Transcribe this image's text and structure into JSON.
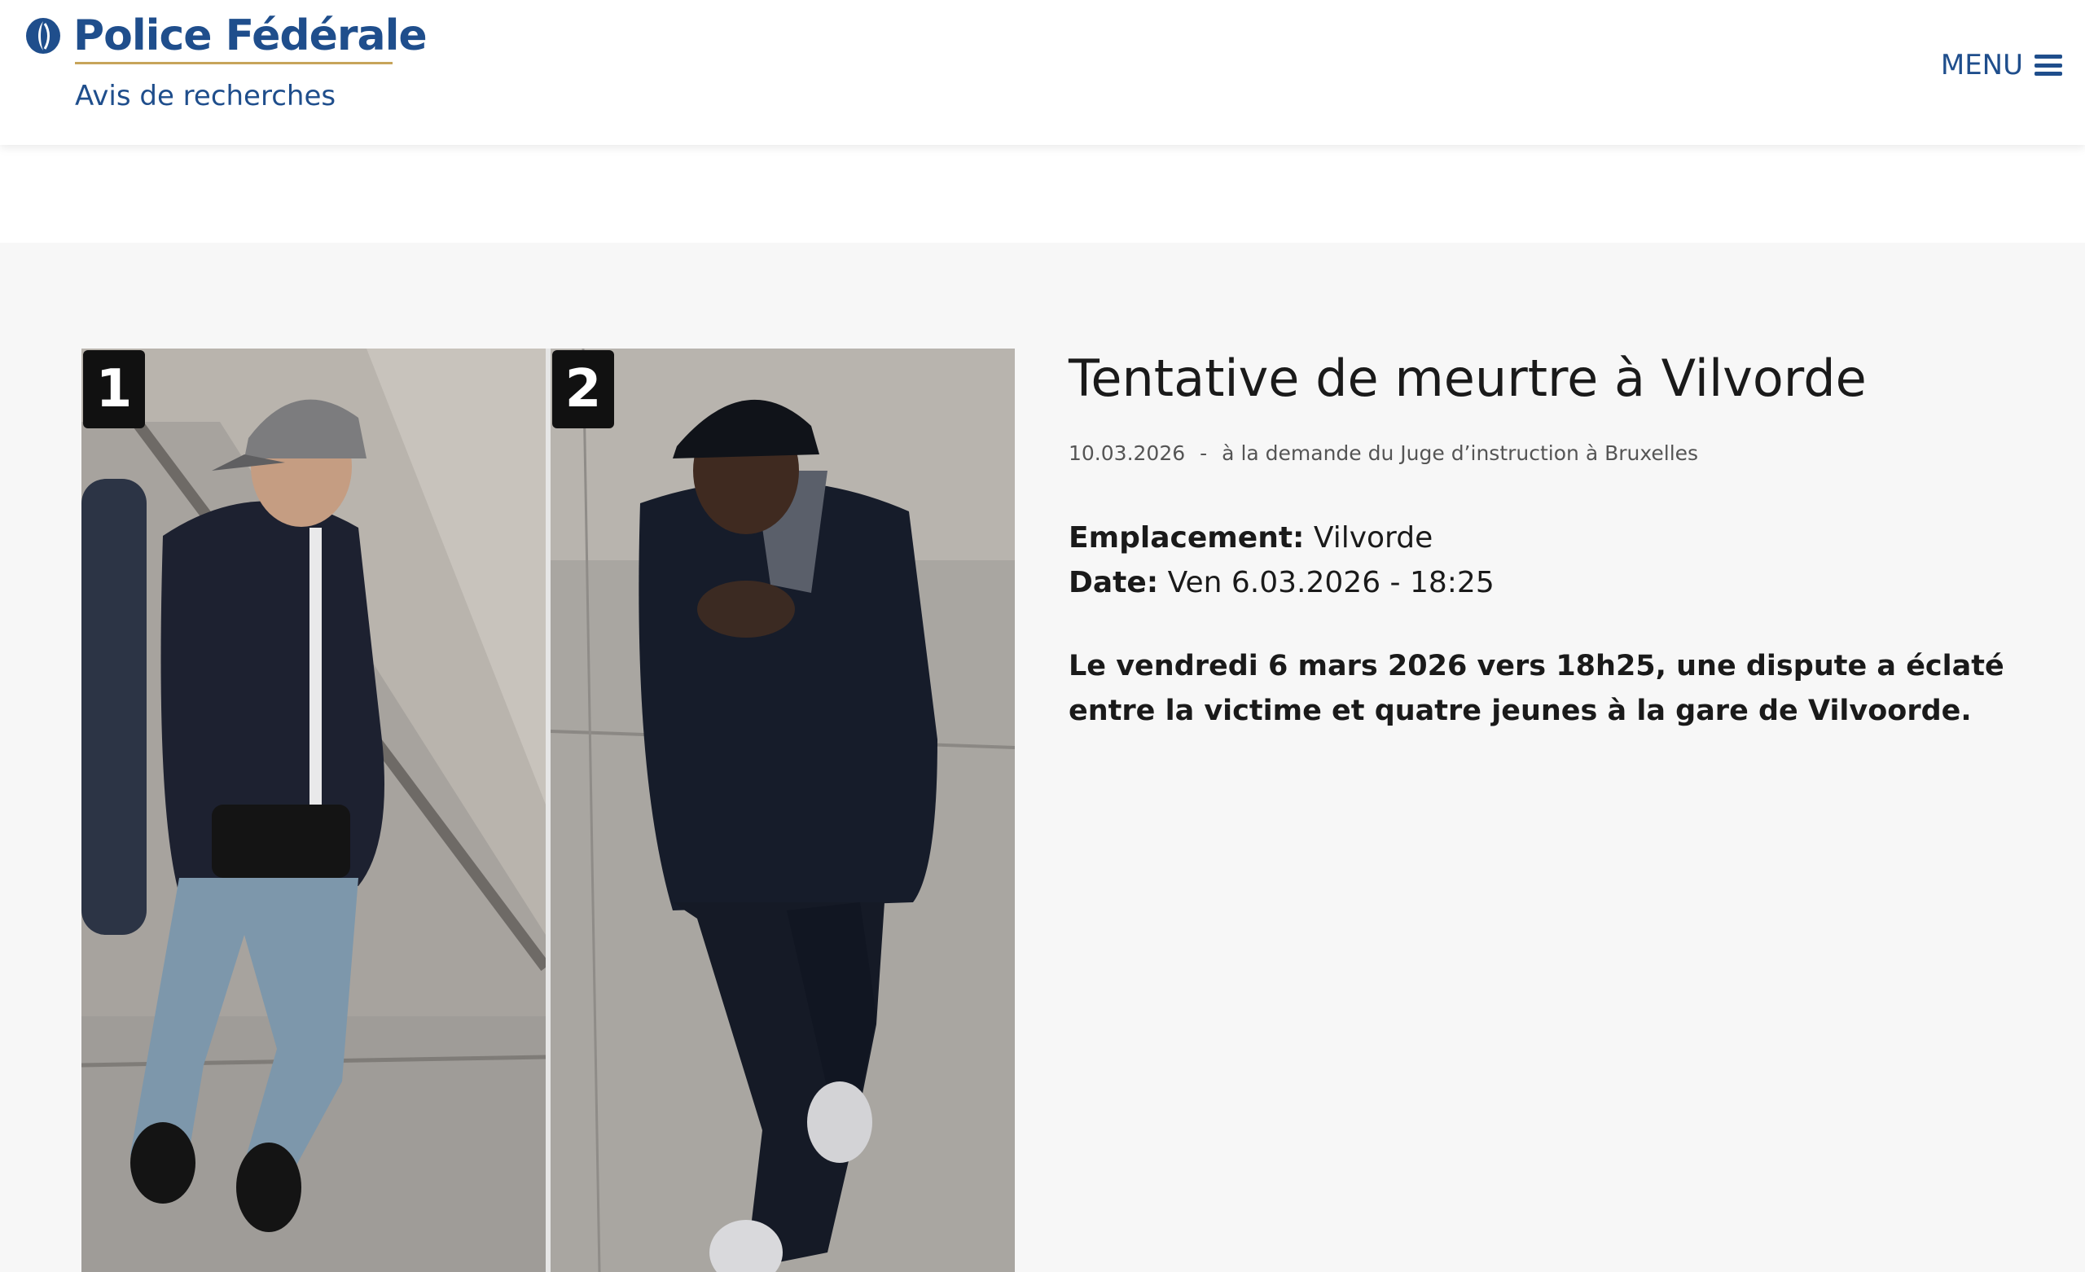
{
  "header": {
    "logo_title": "Police Fédérale",
    "logo_subtitle": "Avis de recherches",
    "menu_label": "MENU",
    "brand_color": "#1f4e8c",
    "accent_color": "#c7a45a"
  },
  "article": {
    "title": "Tentative de meurtre à Vilvorde",
    "date": "10.03.2026",
    "separator": "-",
    "requested_by": "à la demande du Juge d’instruction à Bruxelles",
    "location_label": "Emplacement:",
    "location_value": "Vilvorde",
    "date_label": "Date:",
    "date_value": "Ven 6.03.2026 - 18:25",
    "lead": "Le vendredi 6 mars 2026 vers 18h25, une dispute a éclaté entre la victime et quatre jeunes à la gare de Vilvoorde."
  },
  "photos": [
    {
      "number": "1"
    },
    {
      "number": "2"
    }
  ]
}
